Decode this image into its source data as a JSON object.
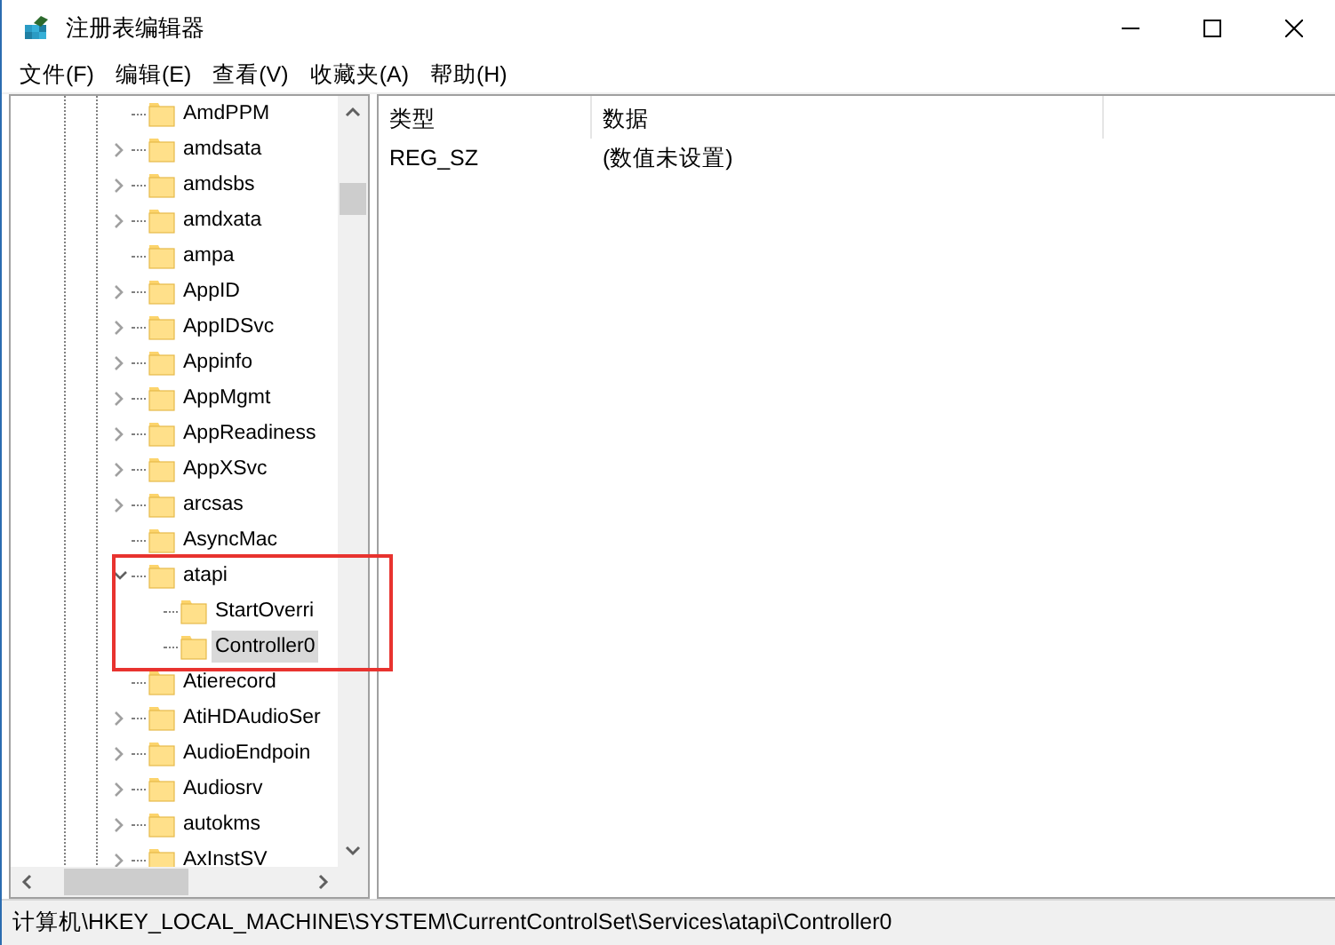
{
  "window": {
    "title": "注册表编辑器"
  },
  "menu": [
    "文件(F)",
    "编辑(E)",
    "查看(V)",
    "收藏夹(A)",
    "帮助(H)"
  ],
  "tree": {
    "items": [
      {
        "label": "AmdPPM",
        "selected": false
      },
      {
        "label": "amdsata",
        "expanded": false,
        "selected": false
      },
      {
        "label": "amdsbs",
        "expanded": false,
        "selected": false
      },
      {
        "label": "amdxata",
        "expanded": false,
        "selected": false
      },
      {
        "label": "ampa",
        "selected": false
      },
      {
        "label": "AppID",
        "expanded": false,
        "selected": false
      },
      {
        "label": "AppIDSvc",
        "expanded": false,
        "selected": false
      },
      {
        "label": "Appinfo",
        "expanded": false,
        "selected": false
      },
      {
        "label": "AppMgmt",
        "expanded": false,
        "selected": false
      },
      {
        "label": "AppReadiness",
        "expanded": false,
        "selected": false
      },
      {
        "label": "AppXSvc",
        "expanded": false,
        "selected": false
      },
      {
        "label": "arcsas",
        "expanded": false,
        "selected": false
      },
      {
        "label": "AsyncMac",
        "selected": false
      },
      {
        "label": "atapi",
        "expanded": true,
        "selected": false,
        "highlighted": true,
        "children": [
          {
            "label": "StartOverri",
            "selected": false
          },
          {
            "label": "Controller0",
            "selected": true
          }
        ]
      },
      {
        "label": "Atierecord",
        "selected": false
      },
      {
        "label": "AtiHDAudioSer",
        "expanded": false,
        "selected": false
      },
      {
        "label": "AudioEndpoin",
        "expanded": false,
        "selected": false
      },
      {
        "label": "Audiosrv",
        "expanded": false,
        "selected": false
      },
      {
        "label": "autokms",
        "expanded": false,
        "selected": false
      },
      {
        "label": "AxInstSV",
        "expanded": false,
        "selected": false
      }
    ]
  },
  "values": {
    "columns": [
      "类型",
      "数据"
    ],
    "rows": [
      [
        "REG_SZ",
        "(数值未设置)"
      ]
    ]
  },
  "status_bar": "计算机\\HKEY_LOCAL_MACHINE\\SYSTEM\\CurrentControlSet\\Services\\atapi\\Controller0"
}
